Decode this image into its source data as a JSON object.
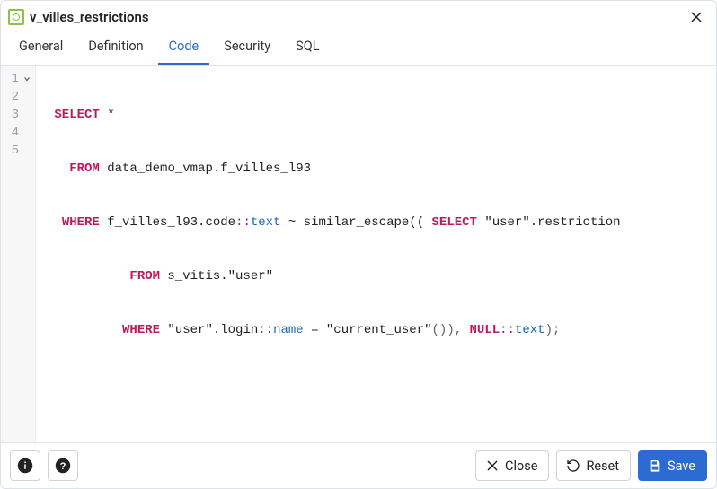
{
  "header": {
    "title": "v_villes_restrictions"
  },
  "tabs": {
    "items": [
      {
        "label": "General",
        "active": false
      },
      {
        "label": "Definition",
        "active": false
      },
      {
        "label": "Code",
        "active": true
      },
      {
        "label": "Security",
        "active": false
      },
      {
        "label": "SQL",
        "active": false
      }
    ]
  },
  "code": {
    "line1": {
      "select": "SELECT",
      "star": " *"
    },
    "line2": {
      "from": "FROM",
      "rest": " data_demo_vmap.f_villes_l93"
    },
    "line3": {
      "where": "WHERE",
      "a": " f_villes_l93.code",
      "cast": "::",
      "type": "text",
      "b": " ~ similar_escape(( ",
      "select2": "SELECT",
      "c": " \"user\".restriction"
    },
    "line4": {
      "from": "FROM",
      "rest": " s_vitis.\"user\""
    },
    "line5": {
      "where": "WHERE",
      "a": " \"user\".login",
      "cast1": "::",
      "type1": "name",
      "eq": " = ",
      "call": "\"current_user\"",
      "p1": "()),",
      "space": " ",
      "null": "NULL",
      "cast2": "::",
      "type2": "text",
      "p2": ");"
    },
    "gutter": [
      "1",
      "2",
      "3",
      "4",
      "5"
    ]
  },
  "footer": {
    "close": "Close",
    "reset": "Reset",
    "save": "Save"
  },
  "colors": {
    "accent": "#2c6bd1",
    "keyword": "#c2185b",
    "cast": "#7b1fa2",
    "typename": "#1565c0"
  }
}
